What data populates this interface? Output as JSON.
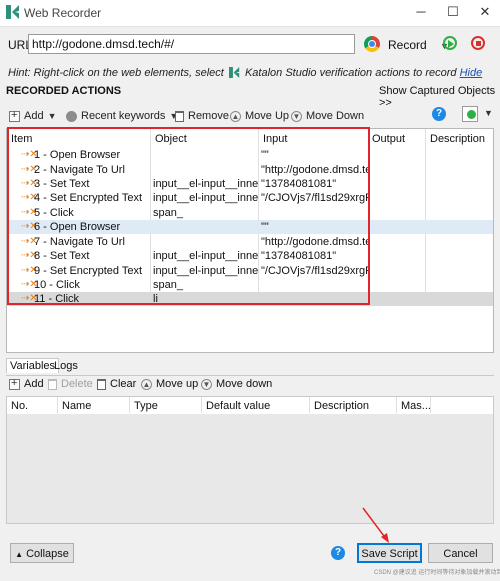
{
  "window": {
    "title": "Web Recorder",
    "minimize": "─",
    "maximize": "☐",
    "close": "✕"
  },
  "url_bar": {
    "label": "URL",
    "value": "http://godone.dmsd.tech/#/",
    "record_label": "Record",
    "browser_icon": "chrome-icon"
  },
  "hint": {
    "text_before": "Hint: Right-click on the web elements, select",
    "text_after": "Katalon Studio verification actions to record",
    "hide_link": "Hide"
  },
  "recorded_actions": {
    "title": "RECORDED ACTIONS",
    "show_captured": "Show Captured Objects >>",
    "toolbar": {
      "add": "Add",
      "recent_keywords": "Recent keywords",
      "remove": "Remove",
      "move_up": "Move Up",
      "move_down": "Move Down"
    },
    "columns": [
      "Item",
      "Object",
      "Input",
      "Output",
      "Description"
    ],
    "rows": [
      {
        "item": "1 - Open Browser",
        "object": "",
        "input": "\"\""
      },
      {
        "item": "2 - Navigate To Url",
        "object": "",
        "input": "\"http://godone.dmsd.tec"
      },
      {
        "item": "3 - Set Text",
        "object": "input__el-input__inner",
        "input": "\"13784081081\""
      },
      {
        "item": "4 - Set Encrypted Text",
        "object": "input__el-input__inner_1",
        "input": "\"/CJOVjs7/fl1sd29xrgRyA"
      },
      {
        "item": "5 - Click",
        "object": "span_",
        "input": ""
      },
      {
        "item": "6 - Open Browser",
        "object": "",
        "input": "\"\""
      },
      {
        "item": "7 - Navigate To Url",
        "object": "",
        "input": "\"http://godone.dmsd.tec"
      },
      {
        "item": "8 - Set Text",
        "object": "input__el-input__inner",
        "input": "\"13784081081\""
      },
      {
        "item": "9 - Set Encrypted Text",
        "object": "input__el-input__inner_1",
        "input": "\"/CJOVjs7/fl1sd29xrgRyA"
      },
      {
        "item": "10 - Click",
        "object": "span_",
        "input": ""
      },
      {
        "item": "11 - Click",
        "object": "li_",
        "input": ""
      }
    ]
  },
  "variables": {
    "tabs": [
      "Variables",
      "Logs"
    ],
    "toolbar": {
      "add": "Add",
      "delete": "Delete",
      "clear": "Clear",
      "move_up": "Move up",
      "move_down": "Move down"
    },
    "columns": [
      "No.",
      "Name",
      "Type",
      "Default value",
      "Description",
      "Mas..."
    ]
  },
  "footer": {
    "collapse": "Collapse",
    "save_script": "Save Script",
    "cancel": "Cancel",
    "watermark": "CSDN @建议追 运行时间等待对象加载并滚动到元素"
  },
  "colors": {
    "highlight_border": "#e0242a",
    "selected_row": "#dfeaf7",
    "step_icon": "#e07b16",
    "link": "#1a4fb3"
  }
}
